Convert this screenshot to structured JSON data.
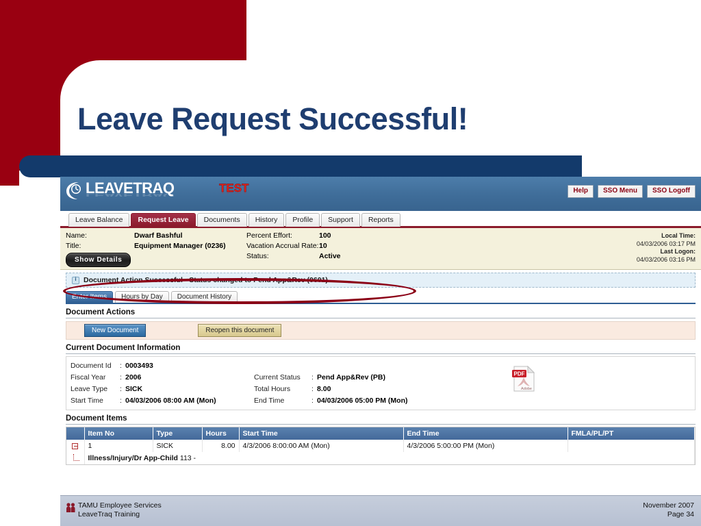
{
  "slide": {
    "title": "Leave Request Successful!",
    "footer": {
      "org_line1": "TAMU Employee Services",
      "org_line2": "LeaveTraq Training",
      "date": "November 2007",
      "page": "Page 34",
      "people_icon": "people-icon"
    },
    "colors": {
      "red_block": "#990011",
      "title_blue": "#1F3E70",
      "bar_blue": "#133A6B",
      "annotation_red": "#8B0016"
    }
  },
  "app": {
    "header": {
      "logo_text": "LEAVETRAQ",
      "logo_icon": "clock-logo-icon",
      "environment_badge": "TEST",
      "buttons": [
        {
          "label": "Help",
          "name": "help-button"
        },
        {
          "label": "SSO Menu",
          "name": "sso-menu-button"
        },
        {
          "label": "SSO Logoff",
          "name": "sso-logoff-button"
        }
      ]
    },
    "main_tabs": [
      {
        "label": "Leave Balance",
        "active": false
      },
      {
        "label": "Request Leave",
        "active": true
      },
      {
        "label": "Documents",
        "active": false
      },
      {
        "label": "History",
        "active": false
      },
      {
        "label": "Profile",
        "active": false
      },
      {
        "label": "Support",
        "active": false
      },
      {
        "label": "Reports",
        "active": false
      }
    ],
    "employee": {
      "name_label": "Name:",
      "name_value": "Dwarf Bashful",
      "title_label": "Title:",
      "title_value": "Equipment Manager (0236)",
      "percent_effort_label": "Percent Effort:",
      "percent_effort_value": "100",
      "vacation_rate_label": "Vacation Accrual Rate:",
      "vacation_rate_value": "10",
      "status_label": "Status:",
      "status_value": "Active",
      "show_details_button": "Show Details",
      "local_time_label": "Local Time:",
      "local_time_value": "04/03/2006 03:17 PM",
      "last_logon_label": "Last Logon:",
      "last_logon_value": "04/03/2006 03:16 PM"
    },
    "message": {
      "icon": "info-icon",
      "text": "Document Action Successful - Status changed to Pend App&Rev (0601)"
    },
    "sub_tabs": [
      {
        "label": "Enter Items",
        "active": true
      },
      {
        "label": "Hours by Day",
        "active": false
      },
      {
        "label": "Document History",
        "active": false
      }
    ],
    "document_actions": {
      "heading": "Document Actions",
      "new_document_button": "New Document",
      "reopen_button": "Reopen this document"
    },
    "current_document": {
      "heading": "Current Document Information",
      "pdf_icon": "pdf-adobe-icon",
      "rows": [
        {
          "label": "Document Id",
          "sep": ":",
          "value": "0003493",
          "label2": "",
          "sep2": "",
          "value2": ""
        },
        {
          "label": "Fiscal Year",
          "sep": ":",
          "value": "2006",
          "label2": "Current Status",
          "sep2": ":",
          "value2": "Pend App&Rev (PB)"
        },
        {
          "label": "Leave Type",
          "sep": ":",
          "value": "SICK",
          "label2": "Total Hours",
          "sep2": ":",
          "value2": "8.00"
        },
        {
          "label": "Start Time",
          "sep": ":",
          "value": "04/03/2006 08:00 AM (Mon)",
          "label2": "End Time",
          "sep2": ":",
          "value2": "04/03/2006 05:00 PM (Mon)"
        }
      ]
    },
    "document_items": {
      "heading": "Document Items",
      "columns": [
        "",
        "Item No",
        "Type",
        "Hours",
        "Start Time",
        "End Time",
        "FMLA/PL/PT"
      ],
      "rows": [
        {
          "expand_icon": "expand-collapse-icon",
          "item_no": "1",
          "type": "SICK",
          "hours": "8.00",
          "start_time": "4/3/2006 8:00:00 AM (Mon)",
          "end_time": "4/3/2006 5:00:00 PM (Mon)",
          "fmla": ""
        }
      ],
      "detail_row": {
        "reason": "Illness/Injury/Dr App-Child",
        "code": "113 -"
      }
    }
  }
}
